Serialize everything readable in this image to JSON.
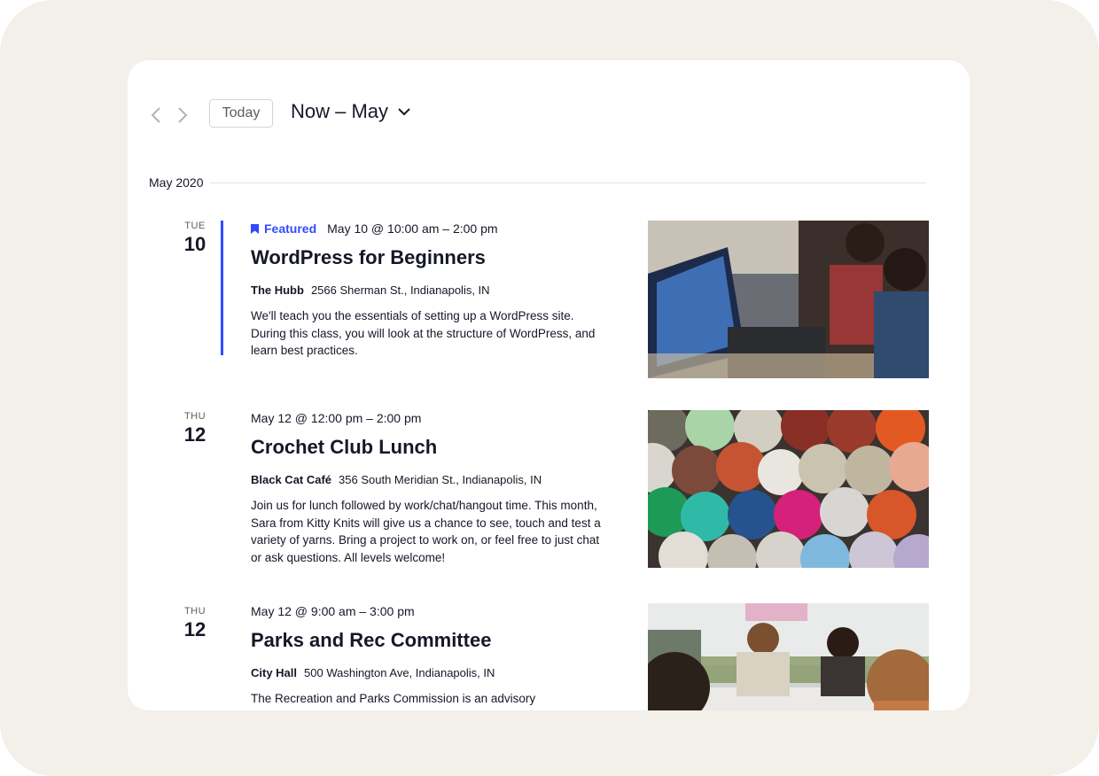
{
  "toolbar": {
    "prev_icon": "chevron-left-icon",
    "next_icon": "chevron-right-icon",
    "today_label": "Today",
    "range_label": "Now – May",
    "range_icon": "chevron-down-icon"
  },
  "month": {
    "label": "May 2020"
  },
  "colors": {
    "accent": "#334aff",
    "text": "#141827",
    "frame": "#f3efe9"
  },
  "events": [
    {
      "dow": "TUE",
      "day": "10",
      "featured_label": "Featured",
      "datetime": "May 10 @ 10:00 am – 2:00 pm",
      "title": "WordPress for Beginners",
      "venue_name": "The Hubb",
      "venue_address": "2566 Sherman St., Indianapolis, IN",
      "description": "We'll teach you the essentials of setting up a WordPress site. During this class, you will look at the structure of WordPress, and learn best practices."
    },
    {
      "dow": "THU",
      "day": "12",
      "datetime": "May 12 @ 12:00 pm – 2:00 pm",
      "title": "Crochet Club Lunch",
      "venue_name": "Black Cat Café",
      "venue_address": "356 South Meridian St., Indianapolis, IN",
      "description": "Join us for lunch followed by work/chat/hangout time. This month, Sara from Kitty Knits will give us a chance to see, touch and test a variety of yarns. Bring a project to work on, or feel free to just chat or ask questions. All levels welcome!"
    },
    {
      "dow": "THU",
      "day": "12",
      "datetime": "May 12 @ 9:00 am – 3:00 pm",
      "title": "Parks and Rec Committee",
      "venue_name": "City Hall",
      "venue_address": "500 Washington Ave, Indianapolis, IN",
      "description": "The Recreation and Parks Commission is an advisory commission. This week we'll be discussing turning the Pit into"
    }
  ]
}
